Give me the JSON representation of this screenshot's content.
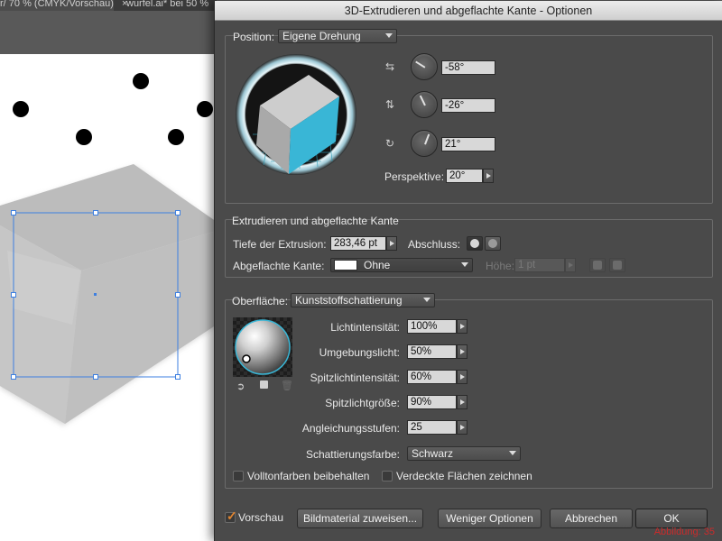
{
  "document": {
    "tab1_title": "r/ 70 % (CMYK/Vorschau)",
    "tab1_close": "×",
    "tab2_title": "wurfel.ai* bei 50 %"
  },
  "dialog": {
    "title": "3D-Extrudieren und abgeflachte Kante - Optionen"
  },
  "position": {
    "label": "Position:",
    "preset": "Eigene Drehung",
    "x_rotation": "-58°",
    "y_rotation": "-26°",
    "z_rotation": "21°",
    "x_icon": "x-axis-rotate-icon",
    "y_icon": "y-axis-rotate-icon",
    "z_icon": "z-axis-rotate-icon",
    "perspective_label": "Perspektive:",
    "perspective": "20°"
  },
  "extrude": {
    "section_title": "Extrudieren und abgeflachte Kante",
    "depth_label": "Tiefe der Extrusion:",
    "depth": "283,46 pt",
    "cap_label": "Abschluss:",
    "bevel_label": "Abgeflachte Kante:",
    "bevel": "Ohne",
    "height_label": "Höhe:",
    "height": "1 pt"
  },
  "surface": {
    "label": "Oberfläche:",
    "type": "Kunststoffschattierung",
    "light_intensity_label": "Lichtintensität:",
    "light_intensity": "100%",
    "ambient_label": "Umgebungslicht:",
    "ambient": "50%",
    "highlight_intensity_label": "Spitzlichtintensität:",
    "highlight_intensity": "60%",
    "highlight_size_label": "Spitzlichtgröße:",
    "highlight_size": "90%",
    "blend_steps_label": "Angleichungsstufen:",
    "blend_steps": "25",
    "shading_color_label": "Schattierungsfarbe:",
    "shading_color": "Schwarz",
    "preserve_spot_label": "Volltonfarben beibehalten",
    "draw_hidden_label": "Verdeckte Flächen zeichnen",
    "preserve_spot_checked": false,
    "draw_hidden_checked": false
  },
  "buttons": {
    "preview_label": "Vorschau",
    "preview_checked": true,
    "map_art": "Bildmaterial zuweisen...",
    "fewer_options": "Weniger Optionen",
    "cancel": "Abbrechen",
    "ok": "OK"
  },
  "watermark": "Abbildung: 35",
  "colors": {
    "cube_face_top": "#8e8e8e",
    "cube_face_side": "#39b6d6",
    "selection": "#3d7fe0",
    "preview_check": "#e08530"
  }
}
